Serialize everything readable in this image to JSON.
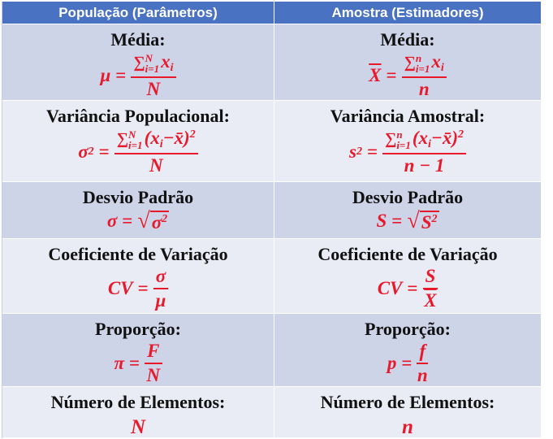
{
  "header": {
    "col1": "População (Parâmetros)",
    "col2": "Amostra (Estimadores)"
  },
  "rows": [
    {
      "left_label": "Média:",
      "right_label": "Média:",
      "left": {
        "lhs": "μ",
        "sum_top": "N",
        "sum_bot": "i=1",
        "term": "x",
        "term_sub": "i",
        "den": "N"
      },
      "right": {
        "lhs": "X",
        "sum_top": "n",
        "sum_bot": "i=1",
        "term": "x",
        "term_sub": "i",
        "den": "n"
      }
    },
    {
      "left_label": "Variância Populacional:",
      "right_label": "Variância Amostral:",
      "left": {
        "lhs": "σ",
        "lhs_sup": "2",
        "sum_top": "N",
        "sum_bot": "i=1",
        "term": "(x",
        "term_sub": "i",
        "term_rest": "−x̄)",
        "term_sup": "2",
        "den": "N"
      },
      "right": {
        "lhs": "s",
        "lhs_sup": "2",
        "sum_top": "n",
        "sum_bot": "i=1",
        "term": "(x",
        "term_sub": "i",
        "term_rest": "−x̄)",
        "term_sup": "2",
        "den": "n − 1"
      }
    },
    {
      "left_label": "Desvio Padrão",
      "right_label": "Desvio Padrão",
      "left": {
        "lhs": "σ",
        "rad": "σ",
        "rad_sup": "2"
      },
      "right": {
        "lhs": "S",
        "rad": "S",
        "rad_sup": "2"
      }
    },
    {
      "left_label": "Coeficiente de Variação",
      "right_label": "Coeficiente de Variação",
      "left": {
        "lhs": "CV",
        "num": "σ",
        "den": "μ"
      },
      "right": {
        "lhs": "CV",
        "num": "S",
        "den": "X"
      }
    },
    {
      "left_label": "Proporção:",
      "right_label": "Proporção:",
      "left": {
        "lhs": "π",
        "num": "F",
        "den": "N"
      },
      "right": {
        "lhs": "p",
        "num": "f",
        "den": "n"
      }
    },
    {
      "left_label": "Número de Elementos:",
      "right_label": "Número de Elementos:",
      "left": {
        "value": "N"
      },
      "right": {
        "value": "n"
      }
    }
  ],
  "equals": "=",
  "sigma": "∑",
  "radical": "√"
}
